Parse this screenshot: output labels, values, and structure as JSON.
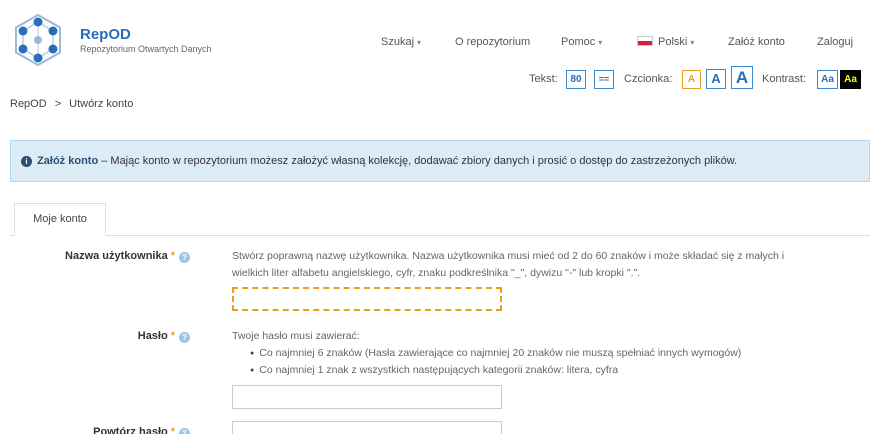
{
  "header": {
    "brand": "RepOD",
    "subtitle": "Repozytorium Otwartych Danych"
  },
  "nav": {
    "search": "Szukaj",
    "about": "O repozytorium",
    "help": "Pomoc",
    "language": "Polski",
    "register": "Załóż konto",
    "login": "Zaloguj"
  },
  "accessibility": {
    "text_label": "Tekst:",
    "text_size": "80",
    "text_spacing": "==",
    "font_label": "Czcionka:",
    "font_small": "A",
    "font_medium": "A",
    "font_large": "A",
    "contrast_label": "Kontrast:",
    "contrast_normal": "Aa",
    "contrast_high": "Aa"
  },
  "breadcrumb": {
    "home": "RepOD",
    "separator": ">",
    "current": "Utwórz konto"
  },
  "alert": {
    "title": "Załóż konto",
    "message": " – Mając konto w repozytorium możesz założyć własną kolekcję, dodawać zbiory danych i prosić o dostęp do zastrzeżonych plików."
  },
  "tabs": [
    {
      "label": "Moje konto"
    }
  ],
  "form": {
    "required_mark": "*",
    "username": {
      "label": "Nazwa użytkownika",
      "help_line1": "Stwórz poprawną nazwę użytkownika. Nazwa użytkownika musi mieć od 2 do 60 znaków i może składać się z małych i",
      "help_line2": "wielkich liter alfabetu angielskiego, cyfr, znaku podkreślnika \"_\", dywizu \"-\" lub kropki \".\".",
      "value": ""
    },
    "password": {
      "label": "Hasło",
      "help_intro": "Twoje hasło musi zawierać:",
      "rules": [
        "Co najmniej 6 znaków (Hasła zawierające co najmniej 20 znaków nie muszą spełniać innych wymogów)",
        "Co najmniej 1 znak z wszystkich następujących kategorii znaków: litera, cyfra"
      ],
      "value": ""
    },
    "password_repeat": {
      "label": "Powtórz hasło",
      "value": ""
    }
  },
  "colors": {
    "accent": "#2a6ebb",
    "required": "#e8a020",
    "alert_bg": "#dcecf7"
  }
}
